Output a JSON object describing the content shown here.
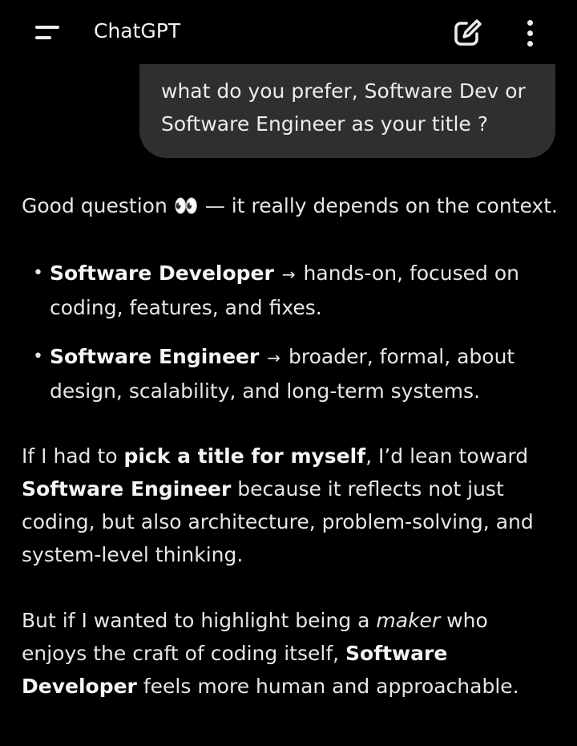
{
  "header": {
    "title": "ChatGPT",
    "menu_icon": "menu-icon",
    "new_chat_icon": "edit-icon",
    "more_icon": "more-vertical-icon"
  },
  "user_message": {
    "text": "what do you prefer, Software Dev or Software Engineer as your title ?"
  },
  "assistant": {
    "intro_before": "Good question ",
    "intro_emoji": "👀",
    "intro_after": " — it really depends on the context.",
    "bullets": [
      {
        "term": "Software Developer",
        "arrow": "→",
        "desc": "hands-on, focused on coding, features, and fixes."
      },
      {
        "term": "Software Engineer",
        "arrow": "→",
        "desc": "broader, formal, about design, scalability, and long-term systems."
      }
    ],
    "para2": {
      "t1": "If I had to ",
      "b1": "pick a title for myself",
      "t2": ", I’d lean toward ",
      "b2": "Software Engineer",
      "t3": " because it reflects not just coding, but also architecture, problem-solving, and system-level thinking."
    },
    "para3": {
      "t1": "But if I wanted to highlight being a ",
      "i1": "maker",
      "t2": " who enjoys the craft of coding itself, ",
      "b1": "Software Developer",
      "t3": " feels more human and approachable."
    }
  },
  "colors": {
    "background": "#000000",
    "bubble": "#2f2f2f",
    "text": "#e6e6e6"
  }
}
